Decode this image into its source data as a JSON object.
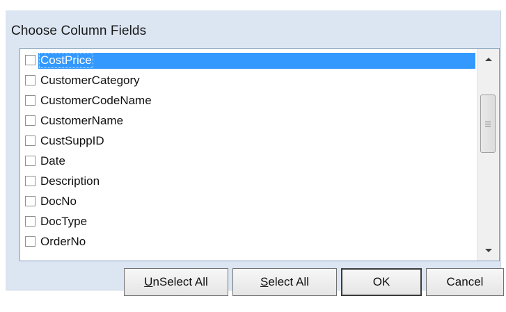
{
  "dialog": {
    "title": "Choose Column Fields"
  },
  "fields": [
    {
      "label": "CostPrice",
      "checked": false,
      "selected": true
    },
    {
      "label": "CustomerCategory",
      "checked": false,
      "selected": false
    },
    {
      "label": "CustomerCodeName",
      "checked": false,
      "selected": false
    },
    {
      "label": "CustomerName",
      "checked": false,
      "selected": false
    },
    {
      "label": "CustSuppID",
      "checked": false,
      "selected": false
    },
    {
      "label": "Date",
      "checked": false,
      "selected": false
    },
    {
      "label": "Description",
      "checked": false,
      "selected": false
    },
    {
      "label": "DocNo",
      "checked": false,
      "selected": false
    },
    {
      "label": "DocType",
      "checked": false,
      "selected": false
    },
    {
      "label": "OrderNo",
      "checked": false,
      "selected": false
    }
  ],
  "buttons": {
    "unselect_all": {
      "mnemonic": "U",
      "rest": "nSelect All"
    },
    "select_all": {
      "mnemonic": "S",
      "rest": "elect All"
    },
    "ok": "OK",
    "cancel": "Cancel"
  },
  "colors": {
    "dialog_bg": "#dce6f2",
    "selection": "#3399ff"
  }
}
